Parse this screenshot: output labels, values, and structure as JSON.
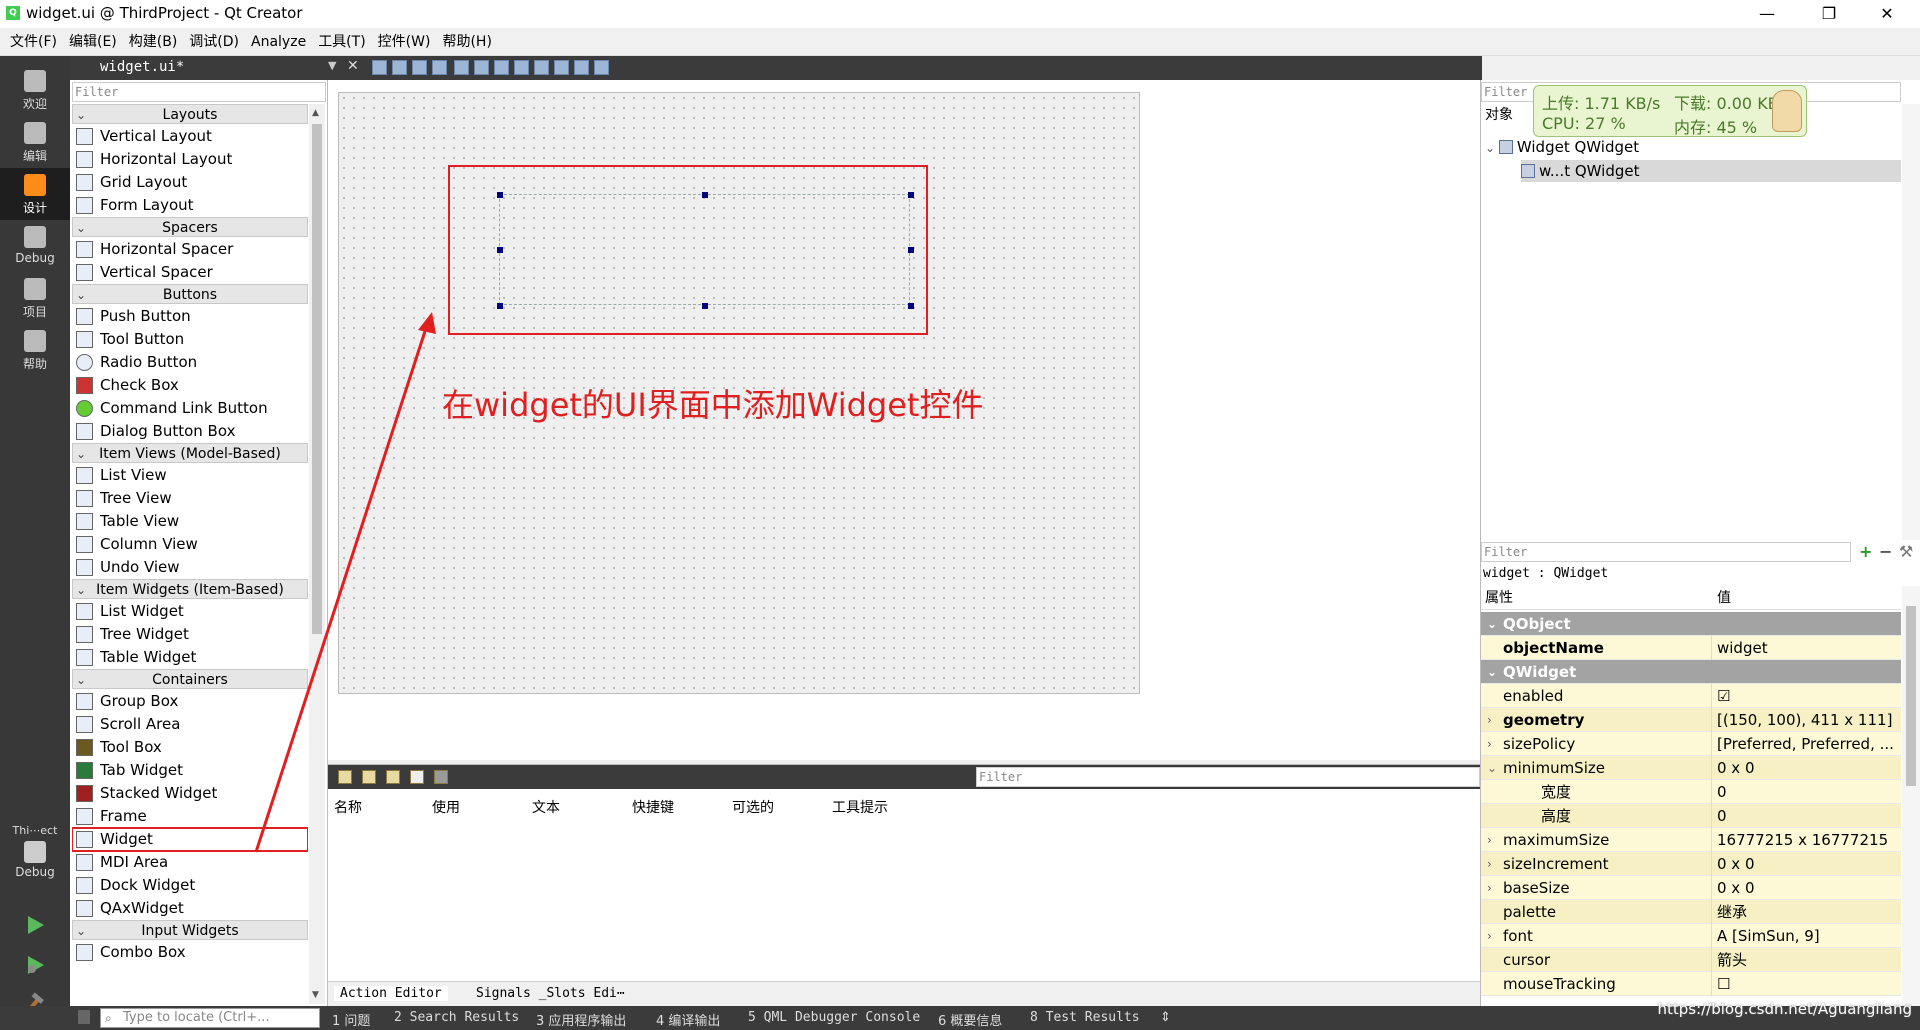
{
  "window": {
    "title": "widget.ui @ ThirdProject - Qt Creator",
    "app_icon": "qt-creator-icon",
    "minimize": "—",
    "maximize": "❐",
    "close": "✕"
  },
  "menu": [
    "文件(F)",
    "编辑(E)",
    "构建(B)",
    "调试(D)",
    "Analyze",
    "工具(T)",
    "控件(W)",
    "帮助(H)"
  ],
  "modes": [
    {
      "label": "欢迎",
      "icon": "welcome-grid-icon"
    },
    {
      "label": "编辑",
      "icon": "edit-document-icon"
    },
    {
      "label": "设计",
      "icon": "design-pen-icon",
      "active": true
    },
    {
      "label": "Debug",
      "icon": "debug-bug-icon"
    },
    {
      "label": "项目",
      "icon": "project-wrench-icon"
    },
    {
      "label": "帮助",
      "icon": "help-question-icon"
    }
  ],
  "kit": {
    "project": "Thi⋯ect",
    "mode": "Debug"
  },
  "editor": {
    "document": "widget.ui*"
  },
  "widget_box": {
    "filter_placeholder": "Filter",
    "categories": [
      {
        "name": "Layouts",
        "items": [
          "Vertical Layout",
          "Horizontal Layout",
          "Grid Layout",
          "Form Layout"
        ]
      },
      {
        "name": "Spacers",
        "items": [
          "Horizontal Spacer",
          "Vertical Spacer"
        ]
      },
      {
        "name": "Buttons",
        "items": [
          "Push Button",
          "Tool Button",
          "Radio Button",
          "Check Box",
          "Command Link Button",
          "Dialog Button Box"
        ]
      },
      {
        "name": "Item Views (Model-Based)",
        "items": [
          "List View",
          "Tree View",
          "Table View",
          "Column View",
          "Undo View"
        ]
      },
      {
        "name": "Item Widgets (Item-Based)",
        "items": [
          "List Widget",
          "Tree Widget",
          "Table Widget"
        ]
      },
      {
        "name": "Containers",
        "items": [
          "Group Box",
          "Scroll Area",
          "Tool Box",
          "Tab Widget",
          "Stacked Widget",
          "Frame",
          "Widget",
          "MDI Area",
          "Dock Widget",
          "QAxWidget"
        ]
      },
      {
        "name": "Input Widgets",
        "items": [
          "Combo Box"
        ]
      }
    ],
    "selected_item": "Widget"
  },
  "annotation": "在widget的UI界面中添加Widget控件",
  "action_editor": {
    "filter_placeholder": "Filter",
    "columns": [
      "名称",
      "使用",
      "文本",
      "快捷键",
      "可选的",
      "工具提示"
    ],
    "tabs": [
      "Action Editor",
      "Signals _Slots Edi⋯"
    ]
  },
  "object_inspector": {
    "filter_placeholder": "Filter",
    "header": "对象",
    "tree": [
      {
        "name": "Widget",
        "class": "QWidget"
      },
      {
        "name": "w...t",
        "class": "QWidget"
      }
    ]
  },
  "net_monitor": {
    "upload": "上传: 1.71 KB/s",
    "download": "下载: 0.00 KB/s",
    "cpu": "CPU: 27 %",
    "memory": "内存: 45 %"
  },
  "property_editor": {
    "filter_placeholder": "Filter",
    "class_line": "widget : QWidget",
    "col_property": "属性",
    "col_value": "值",
    "rows": [
      {
        "kind": "group",
        "name": "QObject"
      },
      {
        "kind": "prop",
        "name": "objectName",
        "value": "widget",
        "bold": true
      },
      {
        "kind": "group",
        "name": "QWidget"
      },
      {
        "kind": "prop",
        "name": "enabled",
        "value": "☑"
      },
      {
        "kind": "prop",
        "name": "geometry",
        "value": "[(150, 100), 411 x 111]",
        "bold": true,
        "expand": "›"
      },
      {
        "kind": "prop",
        "name": "sizePolicy",
        "value": "[Preferred, Preferred, ...",
        "expand": "›"
      },
      {
        "kind": "prop",
        "name": "minimumSize",
        "value": "0 x 0",
        "expand": "⌄"
      },
      {
        "kind": "sub",
        "name": "宽度",
        "value": "0"
      },
      {
        "kind": "sub",
        "name": "高度",
        "value": "0"
      },
      {
        "kind": "prop",
        "name": "maximumSize",
        "value": "16777215 x 16777215",
        "expand": "›"
      },
      {
        "kind": "prop",
        "name": "sizeIncrement",
        "value": "0 x 0",
        "expand": "›"
      },
      {
        "kind": "prop",
        "name": "baseSize",
        "value": "0 x 0",
        "expand": "›"
      },
      {
        "kind": "prop",
        "name": "palette",
        "value": "继承"
      },
      {
        "kind": "prop",
        "name": "font",
        "value": "A [SimSun, 9]",
        "expand": "›"
      },
      {
        "kind": "prop",
        "name": "cursor",
        "value": "箭头"
      },
      {
        "kind": "prop",
        "name": "mouseTracking",
        "value": "☐"
      }
    ]
  },
  "statusbar": {
    "locator_placeholder": "Type to locate (Ctrl+...",
    "outputs": [
      "1 问题",
      "2 Search Results",
      "3 应用程序输出",
      "4 编译输出",
      "5 QML Debugger Console",
      "6 概要信息",
      "8 Test Results"
    ],
    "arrows": "⇕"
  },
  "watermark": "https://blog.csdn.net/Aguangliang",
  "colors": {
    "accent_red": "#e02020",
    "mode_active": "#ff8c1a",
    "dark_bar": "#3b3b3b"
  }
}
